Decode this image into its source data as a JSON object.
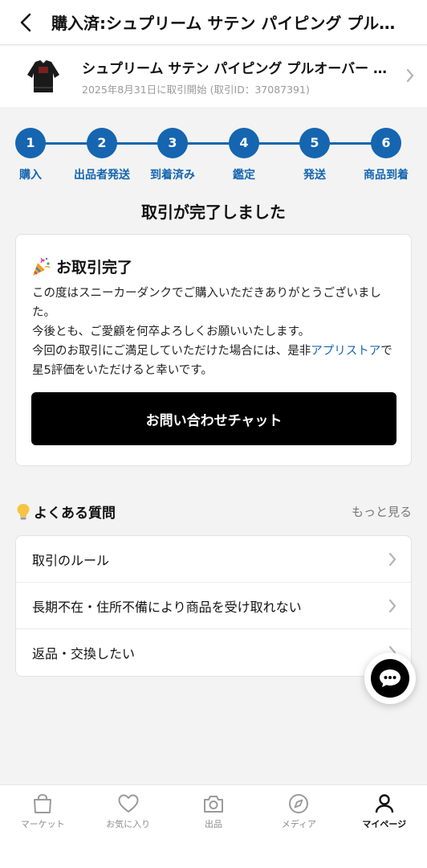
{
  "header": {
    "title": "購入済:シュプリーム サテン パイピング プルオーバー ジャケット"
  },
  "product": {
    "name": "シュプリーム サテン パイピング プルオーバー ジャケット",
    "meta": "2025年8月31日に取引開始 (取引ID：37087391)"
  },
  "steps": [
    {
      "num": "1",
      "label": "購入"
    },
    {
      "num": "2",
      "label": "出品者発送"
    },
    {
      "num": "3",
      "label": "到着済み"
    },
    {
      "num": "4",
      "label": "鑑定"
    },
    {
      "num": "5",
      "label": "発送"
    },
    {
      "num": "6",
      "label": "商品到着"
    }
  ],
  "status_title": "取引が完了しました",
  "card": {
    "title": "お取引完了",
    "body_1": "この度はスニーカーダンクでご購入いただきありがとうございました。",
    "body_2": "今後とも、ご愛顧を何卒よろしくお願いいたします。",
    "body_3_pre": "今回のお取引にご満足していただけた場合には、是非",
    "body_3_link": "アプリストア",
    "body_3_post": "で星5評価をいただけると幸いです。",
    "button": "お問い合わせチャット"
  },
  "faq": {
    "title": "よくある質問",
    "more": "もっと見る",
    "items": [
      "取引のルール",
      "長期不在・住所不備により商品を受け取れない",
      "返品・交換したい"
    ]
  },
  "tabs": [
    {
      "label": "マーケット",
      "icon": "bag-icon"
    },
    {
      "label": "お気に入り",
      "icon": "heart-icon"
    },
    {
      "label": "出品",
      "icon": "camera-icon"
    },
    {
      "label": "メディア",
      "icon": "compass-icon"
    },
    {
      "label": "マイページ",
      "icon": "person-icon"
    }
  ],
  "colors": {
    "accent": "#1565b0",
    "button": "#000000"
  }
}
